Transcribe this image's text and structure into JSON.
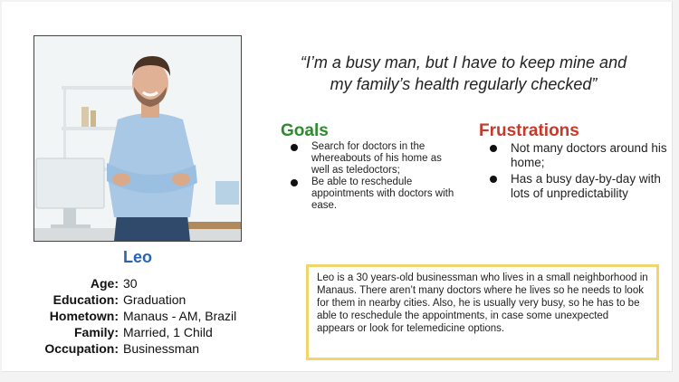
{
  "persona": {
    "name": "Leo",
    "fields": [
      {
        "key": "Age:",
        "value": "30"
      },
      {
        "key": "Education:",
        "value": "Graduation"
      },
      {
        "key": "Hometown:",
        "value": "Manaus - AM, Brazil"
      },
      {
        "key": "Family:",
        "value": "Married, 1 Child"
      },
      {
        "key": "Occupation:",
        "value": "Businessman"
      }
    ]
  },
  "quote": {
    "line1": "“I’m a busy man, but I have to keep mine and",
    "line2": "my family’s health regularly checked”"
  },
  "goals": {
    "title": "Goals",
    "items": [
      "Search for doctors in the whereabouts of his home as well as teledoctors;",
      "Be able to reschedule appointments with doctors with ease."
    ]
  },
  "frustrations": {
    "title": "Frustrations",
    "items": [
      "Not many doctors around his home;",
      "Has a busy day-by-day with lots of unpredictability"
    ]
  },
  "bio": "Leo is a 30 years-old businessman who lives in a small neighborhood in Manaus. There aren’t many doctors where he lives so he needs to look for them in nearby cities. Also, he is usually very busy, so he has to be able to reschedule the appointments, in case some unexpected appears or look for telemedicine options.",
  "colors": {
    "name": "#2a63b0",
    "goals": "#2e8b2e",
    "frustrations": "#c53a2a",
    "bio_border": "#f1d66d"
  }
}
